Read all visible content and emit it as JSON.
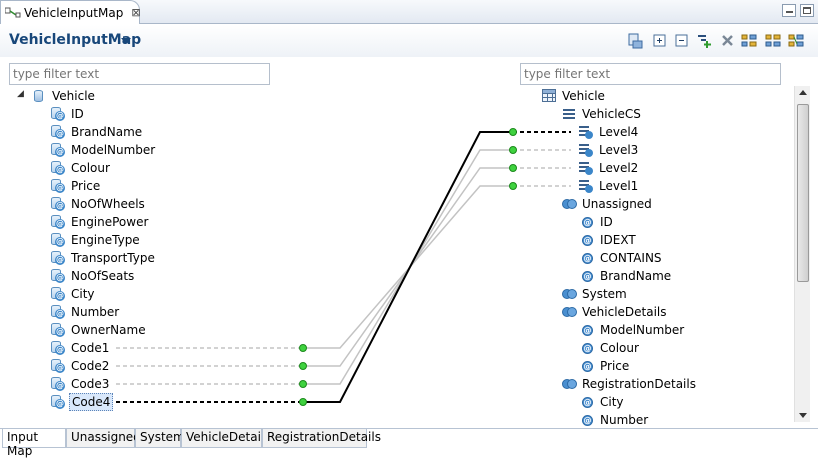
{
  "editor_tab": {
    "title": "VehicleInputMap",
    "close_glyph": "⊠"
  },
  "header": {
    "title": "VehicleInputMap",
    "toolbar_icons": [
      "data-source-icon",
      "expand-all-icon",
      "collapse-all-icon",
      "add-mapping-icon",
      "delete-icon",
      "layout-tree-icon",
      "layout-grid-icon",
      "layout-link-icon"
    ]
  },
  "left": {
    "filter_placeholder": "type filter text",
    "root": "Vehicle",
    "items": [
      "ID",
      "BrandName",
      "ModelNumber",
      "Colour",
      "Price",
      "NoOfWheels",
      "EnginePower",
      "EngineType",
      "TransportType",
      "NoOfSeats",
      "City",
      "Number",
      "OwnerName",
      "Code1",
      "Code2",
      "Code3",
      "Code4"
    ],
    "selected_item": "Code4"
  },
  "right": {
    "filter_placeholder": "type filter text",
    "root": "Vehicle",
    "rows": [
      {
        "label": "VehicleCS",
        "kind": "cs"
      },
      {
        "label": "Level4",
        "kind": "level"
      },
      {
        "label": "Level3",
        "kind": "level"
      },
      {
        "label": "Level2",
        "kind": "level"
      },
      {
        "label": "Level1",
        "kind": "level"
      },
      {
        "label": "Unassigned",
        "kind": "group"
      },
      {
        "label": "ID",
        "kind": "attr"
      },
      {
        "label": "IDEXT",
        "kind": "attr"
      },
      {
        "label": "CONTAINS",
        "kind": "attr"
      },
      {
        "label": "BrandName",
        "kind": "attr"
      },
      {
        "label": "System",
        "kind": "group"
      },
      {
        "label": "VehicleDetails",
        "kind": "group"
      },
      {
        "label": "ModelNumber",
        "kind": "attr"
      },
      {
        "label": "Colour",
        "kind": "attr"
      },
      {
        "label": "Price",
        "kind": "attr"
      },
      {
        "label": "RegistrationDetails",
        "kind": "group"
      },
      {
        "label": "City",
        "kind": "attr"
      },
      {
        "label": "Number",
        "kind": "attr"
      }
    ]
  },
  "mappings": [
    {
      "from": "Code1",
      "to": "Level1",
      "active": false
    },
    {
      "from": "Code2",
      "to": "Level2",
      "active": false
    },
    {
      "from": "Code3",
      "to": "Level3",
      "active": false
    },
    {
      "from": "Code4",
      "to": "Level4",
      "active": true
    }
  ],
  "bottom_tabs": [
    "Input Map",
    "Unassigned",
    "System",
    "VehicleDetails",
    "RegistrationDetails"
  ],
  "active_bottom_tab": "Input Map",
  "colors": {
    "title": "#18477a",
    "mapping_inactive": "#c3c3c3",
    "mapping_active": "#000000",
    "mapping_dot": "#3fd23f",
    "selection": "#d9e8fb"
  }
}
